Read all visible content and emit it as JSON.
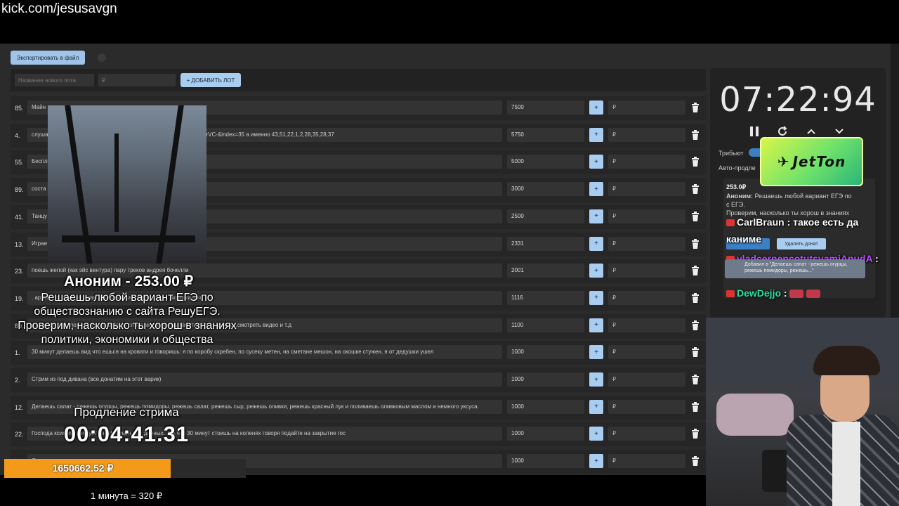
{
  "url": "kick.com/jesusavgn",
  "toolbar": {
    "export_label": "Экспортировать в файл",
    "lot_name_placeholder": "Название нового лота",
    "lot_price_placeholder": "₽",
    "add_lot_label": "+ ДОБАВИТЬ ЛОТ"
  },
  "lots": [
    {
      "idx": "85.",
      "text": "Майн",
      "amount": "7500",
      "plus": "+",
      "rub": "₽"
    },
    {
      "idx": "4.",
      "text": "слушае                                                                                                    =kcw4VPDG9Lw&list=PL2oDcoHo5WQ0YtkDvyplkKRTisN4KrVC-&index=35 а именно 43,51,22,1,2,28,35,28,37",
      "amount": "5750",
      "plus": "+",
      "rub": "₽"
    },
    {
      "idx": "55.",
      "text": "Беспл",
      "amount": "5000",
      "plus": "+",
      "rub": "₽"
    },
    {
      "idx": "89.",
      "text": "соста                                                                                                     шь випки",
      "amount": "3000",
      "plus": "+",
      "rub": "₽"
    },
    {
      "idx": "41.",
      "text": "Танцу                                                                                                     крыльшки / какашки мне в кармашки",
      "amount": "2500",
      "plus": "+",
      "rub": "₽"
    },
    {
      "idx": "13.",
      "text": "Играе",
      "amount": "2331",
      "plus": "+",
      "rub": "₽"
    },
    {
      "idx": "23.",
      "text": "поешь жепой (как эйс вентура) пару треков андрея бочелли",
      "amount": "2001",
      "plus": "+",
      "rub": "₽"
    },
    {
      "idx": "19.",
      "text": "                                                                                                    . артой. по. лыгыдышкам. Лыгыдышкам крыльшкам. ихихихи чач",
      "amount": "1116",
      "plus": "+",
      "rub": "₽"
    },
    {
      "idx": "80.",
      "text": "                                                                                                    в каждом предложении добавляешь слово мяу.Можешь ввести стрим дальше,смотреть видео и т.д",
      "amount": "1100",
      "plus": "+",
      "rub": "₽"
    },
    {
      "idx": "1.",
      "text": "30 минут делаешь вид что                  ешься на кровати и говоришь: я по коробу скребен, по сусеку метен, на сметане мешон, на окошке стужен, я от дедушки ушел",
      "amount": "1000",
      "plus": "+",
      "rub": "₽"
    },
    {
      "idx": "2.",
      "text": "Стрим из под дивана (все донатим на этот варик)",
      "amount": "1000",
      "plus": "+",
      "rub": "₽"
    },
    {
      "idx": "12.",
      "text": "Делаешь салат - режешь огурцы, режешь помидоры, режешь салат, режешь сыр, режешь оливки, режешь красный лук и поливаешь оливковым маслом и немного уксуса.",
      "amount": "1000",
      "plus": "+",
      "rub": "₽"
    },
    {
      "idx": "22.",
      "text": "Господа                                                                      ксимум, следует из официальных данных. Так что 30 минут стоишь на коленях говоря подайте на закрытие гос",
      "amount": "1000",
      "plus": "+",
      "rub": "₽"
    },
    {
      "idx": "",
      "text": "                                                                         Q",
      "amount": "1000",
      "plus": "+",
      "rub": "₽"
    }
  ],
  "timer": {
    "value": "07:22:94",
    "tribute_label": "Трибьют",
    "auto_label": "Авто-продле"
  },
  "donation": {
    "amount": "253.0₽",
    "author": "Аноним:",
    "text": "Решаешь любой вариант ЕГЭ по",
    "text2": "с                                ЕГЭ.",
    "text3": "Проверим, насколько ты хорош в знаниях",
    "delete_label": "Удалить донат"
  },
  "sponsor": {
    "name": "JetTon",
    "mark": "✈"
  },
  "chat": {
    "line1_user": "CarlBraun",
    "line1_text": ": такое есть да",
    "line1_cont": "каниме",
    "line2_user": "vladcernencotutsvamiAnudA",
    "line2_text": ":",
    "line2_card": "Добавил в \"Делаешь салат - режешь огурцы, режешь помидоры, режешь...\"",
    "line3_user": "DewDejjo",
    "line3_text": ":",
    "color_user1": "#f4f4f4",
    "color_user2": "#b64cff",
    "color_user3": "#29e3a3"
  },
  "alert": {
    "title": "Аноним - 253.00 ₽",
    "message": "Решаешь любой вариант ЕГЭ по обществознанию с сайта РешуЕГЭ. Проверим, насколько ты хорош в знаниях политики, экономики и общества"
  },
  "extension": {
    "label": "Продление стрима",
    "timer": "00:04:41.31"
  },
  "goal": {
    "total": "1650662.52 ₽",
    "progress": 0.69,
    "rate": "1 минута = 320 ₽"
  }
}
